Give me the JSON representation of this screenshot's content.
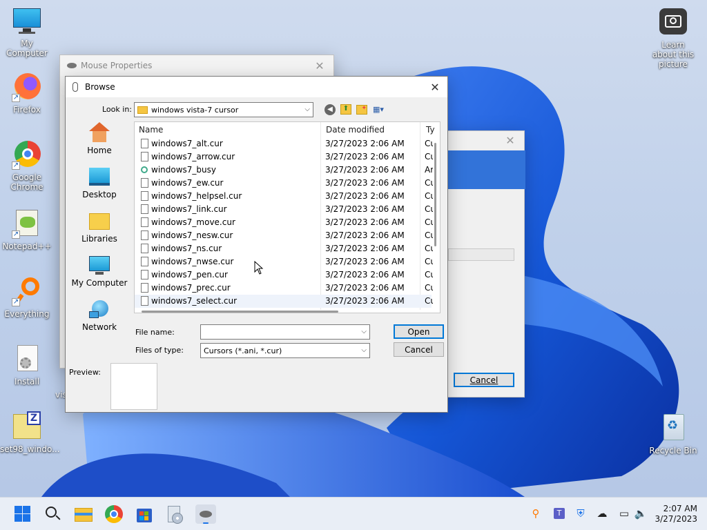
{
  "desktop": {
    "icons": [
      {
        "label": "My Computer",
        "icon": "monitor-icon"
      },
      {
        "label": "Firefox",
        "icon": "firefox-icon"
      },
      {
        "label": "Google Chrome",
        "icon": "chrome-icon"
      },
      {
        "label": "Notepad++",
        "icon": "notepadpp-icon"
      },
      {
        "label": "Everything",
        "icon": "search-magnifier-icon"
      },
      {
        "label": "Install",
        "icon": "installer-icon"
      },
      {
        "label": "set98_windo...",
        "icon": "zip-icon"
      },
      {
        "label": "Learn about this picture",
        "icon": "camera-icon"
      },
      {
        "label": "Recycle Bin",
        "icon": "recycle-bin-icon"
      }
    ],
    "partial_label": "vis"
  },
  "mouse_properties": {
    "title": "Mouse Properties"
  },
  "back_dialog": {
    "cancel_label": "Cancel"
  },
  "browse": {
    "title": "Browse",
    "look_in_label": "Look in:",
    "look_in_value": "windows vista-7 cursor",
    "places": [
      {
        "label": "Home",
        "icon": "home-icon"
      },
      {
        "label": "Desktop",
        "icon": "desktop-icon"
      },
      {
        "label": "Libraries",
        "icon": "libraries-icon"
      },
      {
        "label": "My Computer",
        "icon": "computer-icon"
      },
      {
        "label": "Network",
        "icon": "network-icon"
      }
    ],
    "columns": {
      "name": "Name",
      "date": "Date modified",
      "type": "Ty"
    },
    "files": [
      {
        "name": "windows7_alt.cur",
        "date": "3/27/2023 2:06 AM",
        "type": "Cu",
        "kind": "cur"
      },
      {
        "name": "windows7_arrow.cur",
        "date": "3/27/2023 2:06 AM",
        "type": "Cu",
        "kind": "cur"
      },
      {
        "name": "windows7_busy",
        "date": "3/27/2023 2:06 AM",
        "type": "Ar",
        "kind": "ani"
      },
      {
        "name": "windows7_ew.cur",
        "date": "3/27/2023 2:06 AM",
        "type": "Cu",
        "kind": "cur"
      },
      {
        "name": "windows7_helpsel.cur",
        "date": "3/27/2023 2:06 AM",
        "type": "Cu",
        "kind": "cur"
      },
      {
        "name": "windows7_link.cur",
        "date": "3/27/2023 2:06 AM",
        "type": "Cu",
        "kind": "cur"
      },
      {
        "name": "windows7_move.cur",
        "date": "3/27/2023 2:06 AM",
        "type": "Cu",
        "kind": "cur"
      },
      {
        "name": "windows7_nesw.cur",
        "date": "3/27/2023 2:06 AM",
        "type": "Cu",
        "kind": "cur"
      },
      {
        "name": "windows7_ns.cur",
        "date": "3/27/2023 2:06 AM",
        "type": "Cu",
        "kind": "cur"
      },
      {
        "name": "windows7_nwse.cur",
        "date": "3/27/2023 2:06 AM",
        "type": "Cu",
        "kind": "cur"
      },
      {
        "name": "windows7_pen.cur",
        "date": "3/27/2023 2:06 AM",
        "type": "Cu",
        "kind": "cur"
      },
      {
        "name": "windows7_prec.cur",
        "date": "3/27/2023 2:06 AM",
        "type": "Cu",
        "kind": "cur"
      },
      {
        "name": "windows7_select.cur",
        "date": "3/27/2023 2:06 AM",
        "type": "Cu",
        "kind": "cur"
      }
    ],
    "file_name_label": "File name:",
    "file_name_value": "",
    "file_type_label": "Files of type:",
    "file_type_value": "Cursors (*.ani, *.cur)",
    "open_label": "Open",
    "cancel_label": "Cancel",
    "preview_label": "Preview:"
  },
  "taskbar": {
    "apps": [
      "windows-start-icon",
      "search-icon",
      "file-explorer-icon",
      "chrome-icon",
      "store-icon",
      "disc-setup-icon",
      "mouse-icon"
    ],
    "tray": [
      "everything-tray-icon",
      "teams-icon",
      "defender-icon",
      "cloud-offline-icon",
      "network-icon",
      "volume-icon"
    ],
    "time": "2:07 AM",
    "date": "3/27/2023"
  },
  "colors": {
    "accent": "#0078d7",
    "wallpaper_blue": "#1556d6"
  }
}
